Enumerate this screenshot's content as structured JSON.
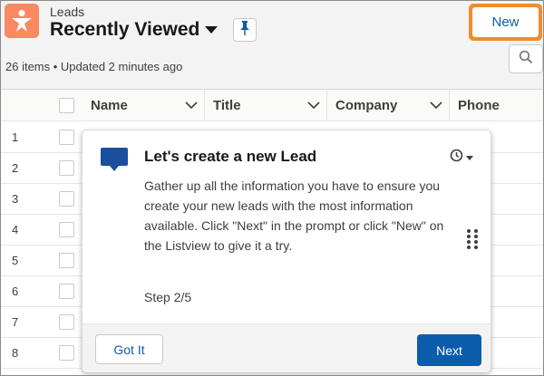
{
  "header": {
    "object_label": "Leads",
    "list_view_title": "Recently Viewed",
    "new_button_label": "New",
    "status_text": "26 items • Updated 2 minutes ago"
  },
  "table": {
    "columns": [
      {
        "label": "Name"
      },
      {
        "label": "Title"
      },
      {
        "label": "Company"
      },
      {
        "label": "Phone"
      }
    ],
    "row_numbers": [
      "1",
      "2",
      "3",
      "4",
      "5",
      "6",
      "7",
      "8"
    ]
  },
  "prompt": {
    "title": "Let's create a new Lead",
    "body": "Gather up all the information you have to ensure you create your new leads with the most information available. Click \"Next\" in the prompt or click \"New\" on the Listview to give it a try.",
    "step": "Step 2/5",
    "got_it_label": "Got It",
    "next_label": "Next"
  },
  "colors": {
    "lead_icon_bg": "#f88962",
    "highlight_outline": "#f08c2a",
    "brand_blue": "#0b5cab",
    "prompt_icon": "#1b4f9c"
  },
  "icons": {
    "app": "lead-star-icon",
    "list_caret": "caret-down-icon",
    "pin": "pin-icon",
    "search": "search-icon",
    "column_menu": "chevron-down-icon",
    "prompt": "chat-bubble-icon",
    "prompt_snooze": "clock-icon",
    "prompt_drag": "drag-handle-icon"
  }
}
